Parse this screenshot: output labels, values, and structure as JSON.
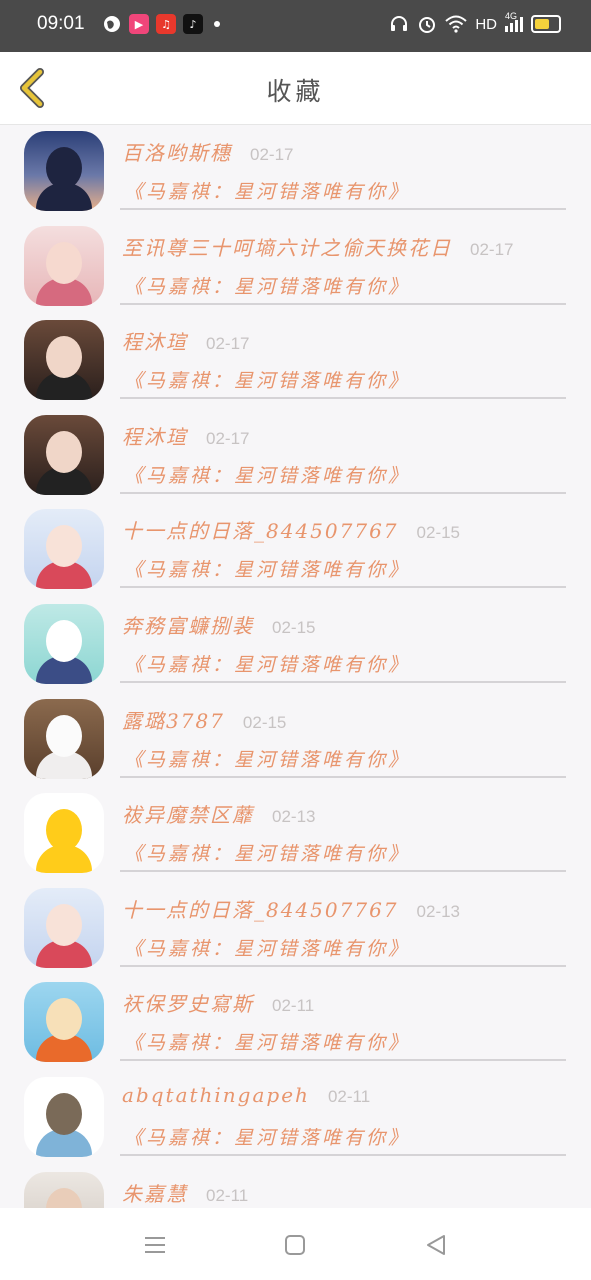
{
  "status_bar": {
    "time": "09:01",
    "left_icons": [
      "globe-icon",
      "video-app-icon",
      "music-app-icon",
      "tiktok-icon",
      "notification-dot"
    ],
    "right_icons": [
      "headphones-icon",
      "alarm-icon",
      "wifi-icon",
      "hd-badge",
      "signal-4g-icon",
      "battery-icon"
    ],
    "hd_label": "HD",
    "network_label": "4G",
    "battery_level": 0.75,
    "battery_color": "#f5d23c"
  },
  "header": {
    "title": "收藏",
    "back_icon": "chevron-left-icon",
    "accent_color": "#e6c43a"
  },
  "list": {
    "text_color": "#e8956d",
    "items": [
      {
        "name": "百洛哟斯穗",
        "date": "02-17",
        "song": "《马嘉祺：星河错落唯有你》",
        "avatar": "dusk-silhouette"
      },
      {
        "name": "至讯尊三十呵墒六计之偷天换花日",
        "date": "02-17",
        "song": "《马嘉祺：星河错落唯有你》",
        "avatar": "girl-portrait"
      },
      {
        "name": "程沐瑄",
        "date": "02-17",
        "song": "《马嘉祺：星河错落唯有你》",
        "avatar": "girl-uniform"
      },
      {
        "name": "程沐瑄",
        "date": "02-17",
        "song": "《马嘉祺：星河错落唯有你》",
        "avatar": "girl-uniform"
      },
      {
        "name": "十一点的日落_844507767",
        "date": "02-15",
        "song": "《马嘉祺：星河错落唯有你》",
        "avatar": "anime-girl"
      },
      {
        "name": "奔務富蠊捌裴",
        "date": "02-15",
        "song": "《马嘉祺：星河错落唯有你》",
        "avatar": "cartoon-blue"
      },
      {
        "name": "露璐3787",
        "date": "02-15",
        "song": "《马嘉祺：星河错落唯有你》",
        "avatar": "white-dog"
      },
      {
        "name": "祓异魔禁区蘼",
        "date": "02-13",
        "song": "《马嘉祺：星河错落唯有你》",
        "avatar": "yellow-cat-emoji"
      },
      {
        "name": "十一点的日落_844507767",
        "date": "02-13",
        "song": "《马嘉祺：星河错落唯有你》",
        "avatar": "anime-girl"
      },
      {
        "name": "祆保罗史寫斯",
        "date": "02-11",
        "song": "《马嘉祺：星河错落唯有你》",
        "avatar": "orange-cartoon"
      },
      {
        "name": "abqtathingapeh",
        "date": "02-11",
        "song": "《马嘉祺：星河错落唯有你》",
        "avatar": "totoro-bottle"
      },
      {
        "name": "朱嘉慧",
        "date": "02-11",
        "song": "",
        "avatar": "boy-portrait"
      }
    ]
  },
  "nav_bar": {
    "icons": [
      "menu-icon",
      "home-square-icon",
      "back-triangle-icon"
    ]
  }
}
